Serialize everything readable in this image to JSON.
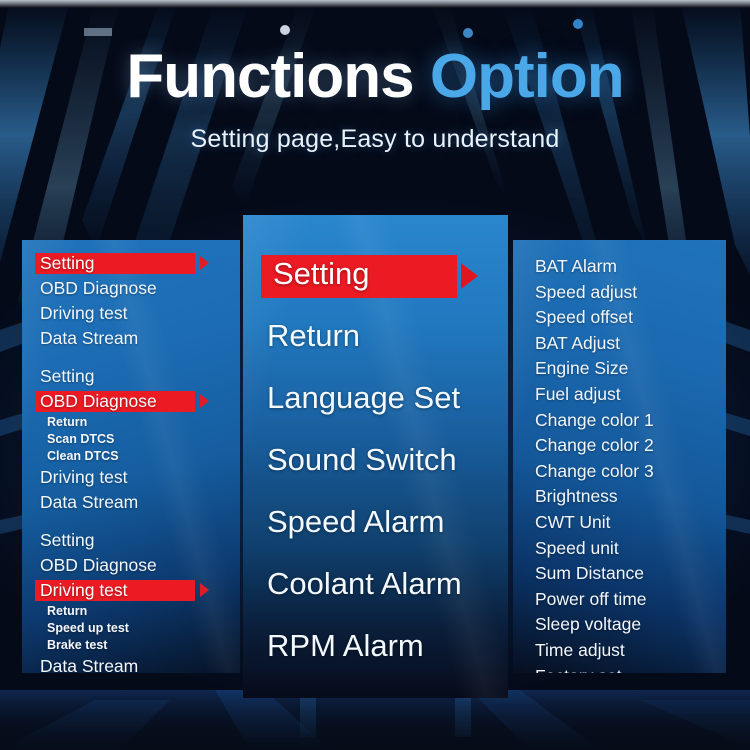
{
  "header": {
    "title_white": "Functions",
    "title_blue": "Option",
    "subtitle": "Setting page,Easy to understand"
  },
  "colors": {
    "highlight_red": "#ec1a23",
    "panel_blue": "#1f73bb",
    "title_blue": "#4aa8e8",
    "text_white": "#f4f9ff",
    "background_navy": "#05070f"
  },
  "left_panel": {
    "name": "menu-navigation-steps",
    "rows": [
      {
        "label": "Setting",
        "level": "main",
        "highlight": true,
        "gap": false
      },
      {
        "label": "OBD Diagnose",
        "level": "main",
        "highlight": false,
        "gap": false
      },
      {
        "label": "Driving test",
        "level": "main",
        "highlight": false,
        "gap": false
      },
      {
        "label": "Data Stream",
        "level": "main",
        "highlight": false,
        "gap": false
      },
      {
        "label": "Setting",
        "level": "main",
        "highlight": false,
        "gap": true
      },
      {
        "label": "OBD Diagnose",
        "level": "main",
        "highlight": true,
        "gap": false
      },
      {
        "label": "Return",
        "level": "sub",
        "highlight": false,
        "gap": false
      },
      {
        "label": "Scan DTCS",
        "level": "sub",
        "highlight": false,
        "gap": false
      },
      {
        "label": "Clean DTCS",
        "level": "sub",
        "highlight": false,
        "gap": false
      },
      {
        "label": "Driving test",
        "level": "main",
        "highlight": false,
        "gap": false
      },
      {
        "label": "Data Stream",
        "level": "main",
        "highlight": false,
        "gap": false
      },
      {
        "label": "Setting",
        "level": "main",
        "highlight": false,
        "gap": true
      },
      {
        "label": "OBD Diagnose",
        "level": "main",
        "highlight": false,
        "gap": false
      },
      {
        "label": "Driving test",
        "level": "main",
        "highlight": true,
        "gap": false
      },
      {
        "label": "Return",
        "level": "sub",
        "highlight": false,
        "gap": false
      },
      {
        "label": "Speed up test",
        "level": "sub",
        "highlight": false,
        "gap": false
      },
      {
        "label": "Brake test",
        "level": "sub",
        "highlight": false,
        "gap": false
      },
      {
        "label": "Data Stream",
        "level": "main",
        "highlight": false,
        "gap": false
      }
    ]
  },
  "center_panel": {
    "name": "settings-main-menu",
    "rows": [
      {
        "label": "Setting",
        "highlight": true
      },
      {
        "label": "Return",
        "highlight": false
      },
      {
        "label": "Language Set",
        "highlight": false
      },
      {
        "label": "Sound Switch",
        "highlight": false
      },
      {
        "label": "Speed Alarm",
        "highlight": false
      },
      {
        "label": "Coolant Alarm",
        "highlight": false
      },
      {
        "label": "RPM Alarm",
        "highlight": false
      }
    ]
  },
  "right_panel": {
    "name": "setting-parameters-list",
    "rows": [
      {
        "label": "BAT Alarm"
      },
      {
        "label": "Speed adjust"
      },
      {
        "label": "Speed offset"
      },
      {
        "label": "BAT Adjust"
      },
      {
        "label": "Engine Size"
      },
      {
        "label": "Fuel adjust"
      },
      {
        "label": "Change color 1"
      },
      {
        "label": "Change color 2"
      },
      {
        "label": "Change color 3"
      },
      {
        "label": "Brightness"
      },
      {
        "label": "CWT Unit"
      },
      {
        "label": "Speed unit"
      },
      {
        "label": "Sum Distance"
      },
      {
        "label": "Power off time"
      },
      {
        "label": "Sleep voltage"
      },
      {
        "label": "Time adjust"
      },
      {
        "label": "Factory set"
      }
    ]
  }
}
